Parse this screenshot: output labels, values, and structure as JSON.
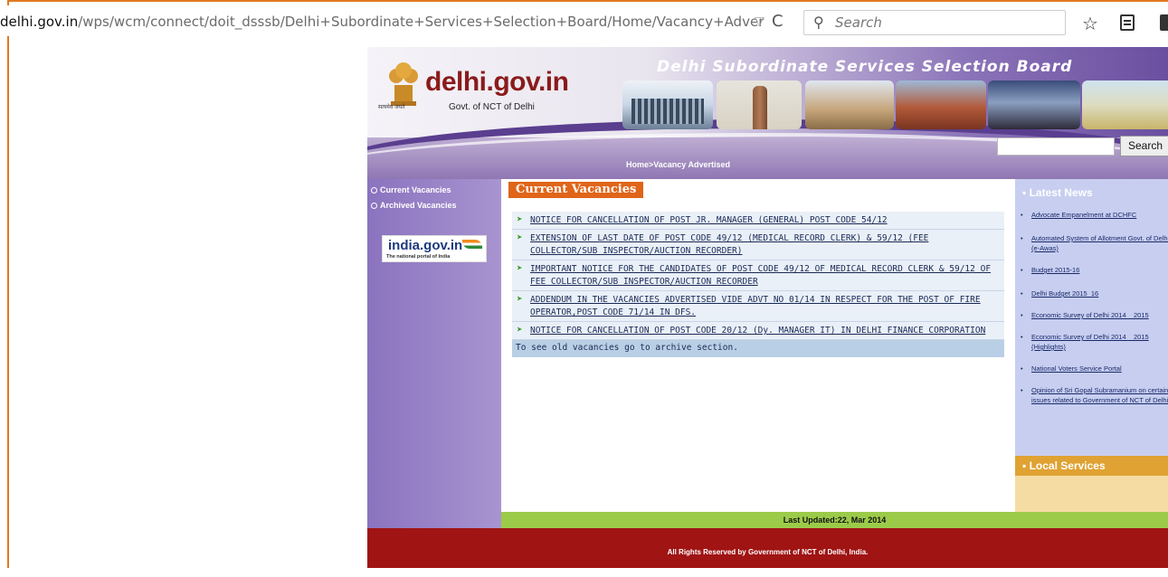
{
  "browser": {
    "url_host": "delhi.gov.in",
    "url_path": "/wps/wcm/connect/doit_dsssb/Delhi+Subordinate+Services+Selection+Board/Home/Vacancy+Adver",
    "search_placeholder": "Search",
    "drop_glyph": "▽",
    "reload_glyph": "C",
    "search_glyph": "🔍",
    "star_glyph": "☆"
  },
  "header": {
    "logo_title": "delhi.gov.in",
    "logo_subtitle": "Govt. of NCT of Delhi",
    "emblem_text": "सत्यमेव जयते",
    "board_title": "Delhi Subordinate Services Selection Board",
    "search_button": "Search",
    "breadcrumb": "Home>Vacancy Advertised"
  },
  "sidebar": {
    "items": [
      {
        "label": "Current Vacancies"
      },
      {
        "label": "Archived Vacancies"
      }
    ],
    "badge_title": "india.gov.in",
    "badge_subtitle": "The national portal of India"
  },
  "main": {
    "section_title": "Current Vacancies",
    "notices": [
      {
        "text": "NOTICE FOR CANCELLATION OF POST JR. MANAGER (GENERAL) POST CODE 54/12"
      },
      {
        "text": "EXTENSION OF LAST DATE OF POST CODE 49/12 (MEDICAL RECORD CLERK) & 59/12 (FEE COLLECTOR/SUB INSPECTOR/AUCTION RECORDER)"
      },
      {
        "text": "IMPORTANT NOTICE FOR THE CANDIDATES OF POST CODE 49/12 OF MEDICAL RECORD CLERK & 59/12 OF FEE COLLECTOR/SUB INSPECTOR/AUCTION RECORDER"
      },
      {
        "text": "ADDENDUM IN THE VACANCIES ADVERTISED VIDE ADVT NO 01/14 IN RESPECT FOR THE POST OF FIRE OPERATOR,POST CODE 71/14 IN DFS."
      },
      {
        "text": "NOTICE FOR CANCELLATION OF POST CODE 20/12 (Dy. MANAGER IT) IN DELHI FINANCE CORPORATION"
      }
    ],
    "archive_note": "To see old vacancies go to archive section."
  },
  "rightcol": {
    "latest_news_title": "Latest News",
    "news": [
      {
        "text": "Advocate Empanelment at DCHFC"
      },
      {
        "text": "Automated System of Allotment Govt. of Delhi (e-Awas)"
      },
      {
        "text": "Budget 2015-16"
      },
      {
        "text": "Delhi Budget 2015_16"
      },
      {
        "text": "Economic Survey of Delhi 2014 _ 2015"
      },
      {
        "text": "Economic Survey of Delhi 2014 _ 2015 (Highlights)"
      },
      {
        "text": "National Voters Service Portal"
      },
      {
        "text": "Opinion of Sri Gopal Subramanium on certain issues related to Government of NCT of Delhi"
      }
    ],
    "local_services_title": "Local Services"
  },
  "footer": {
    "last_updated": "Last Updated:22, Mar 2014",
    "copyright": "All Rights Reserved by Government of NCT of Delhi, India."
  },
  "colors": {
    "frame": "#e07a1f",
    "nav_purple": "#8b73bf",
    "tab_orange": "#e0651a",
    "news_blue": "#c7cef0",
    "updated_green": "#9ccb4a",
    "footer_red": "#a01414"
  }
}
